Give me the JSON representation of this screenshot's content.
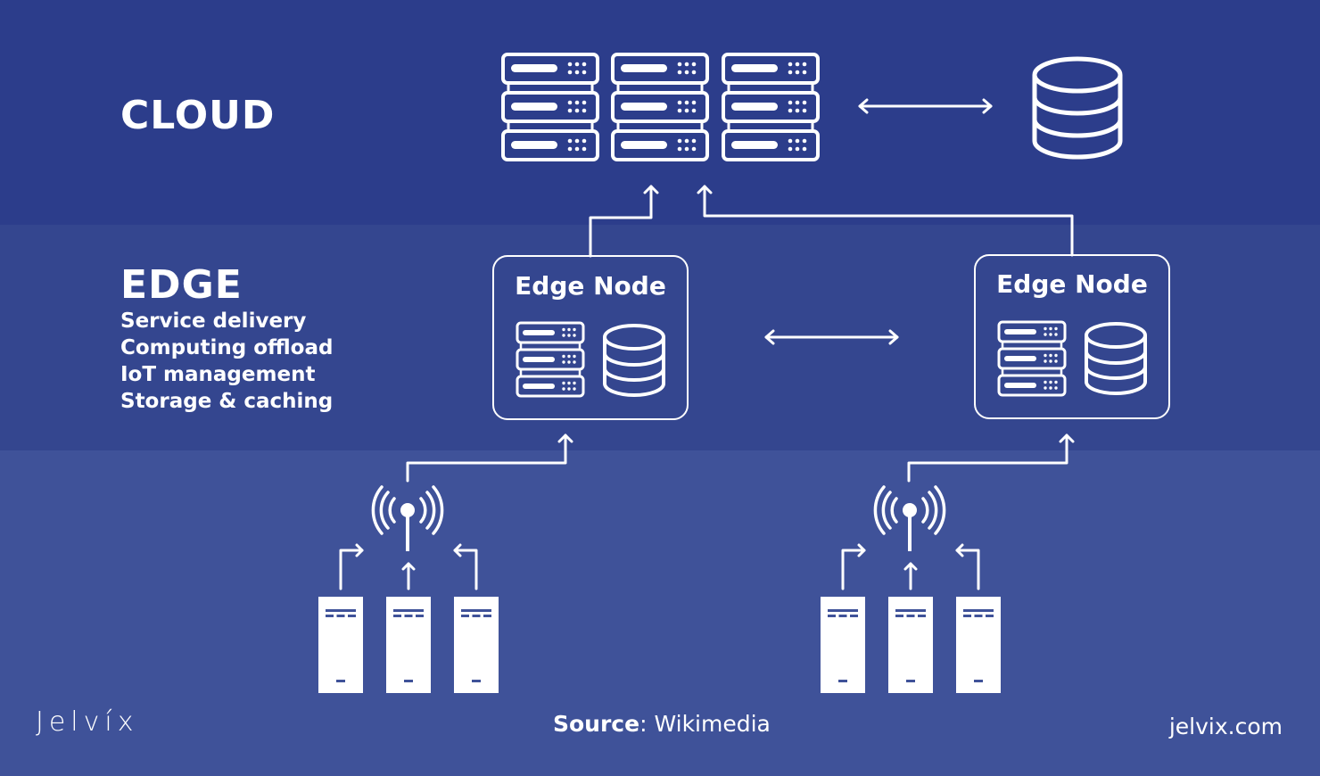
{
  "layers": {
    "cloud": {
      "title": "CLOUD",
      "color": "#2c3d8b"
    },
    "edge": {
      "title": "EDGE",
      "color": "#34468f",
      "features": [
        "Service delivery",
        "Computing offload",
        "IoT management",
        "Storage & caching"
      ]
    },
    "devices": {
      "color": "#3f5299"
    }
  },
  "edge_nodes": [
    {
      "label": "Edge Node",
      "icons": [
        "server-rack-icon",
        "database-icon"
      ]
    },
    {
      "label": "Edge Node",
      "icons": [
        "server-rack-icon",
        "database-icon"
      ]
    }
  ],
  "cloud_components": {
    "server_racks": 3,
    "databases": 1
  },
  "device_groups": [
    {
      "devices": 3,
      "gateway": "wireless-antenna-icon"
    },
    {
      "devices": 3,
      "gateway": "wireless-antenna-icon"
    }
  ],
  "footer": {
    "logo": "Jelvíx",
    "source_label": "Source",
    "source_value": ": Wikimedia",
    "url": "jelvix.com"
  }
}
